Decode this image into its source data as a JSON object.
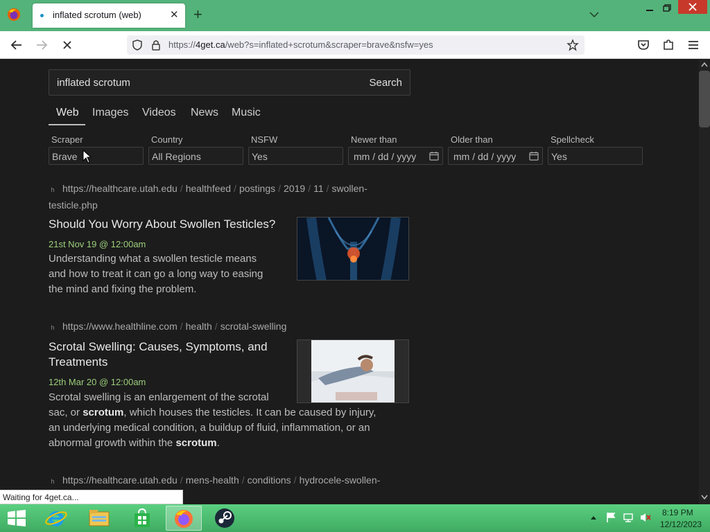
{
  "browser": {
    "tab_title": "inflated scrotum (web)",
    "url_prefix": "https://",
    "url_host": "4get.ca",
    "url_rest": "/web?s=inflated+scrotum&scraper=brave&nsfw=yes",
    "status": "Waiting for 4get.ca..."
  },
  "search": {
    "query": "inflated scrotum",
    "button": "Search"
  },
  "tabs": [
    "Web",
    "Images",
    "Videos",
    "News",
    "Music"
  ],
  "filters": {
    "scraper": {
      "label": "Scraper",
      "value": "Brave"
    },
    "country": {
      "label": "Country",
      "value": "All Regions"
    },
    "nsfw": {
      "label": "NSFW",
      "value": "Yes"
    },
    "newer": {
      "label": "Newer than",
      "value": "mm / dd / yyyy"
    },
    "older": {
      "label": "Older than",
      "value": "mm / dd / yyyy"
    },
    "spellcheck": {
      "label": "Spellcheck",
      "value": "Yes"
    }
  },
  "results": [
    {
      "favicon": "h",
      "url_base": "https://healthcare.utah.edu",
      "url_parts": [
        "healthfeed",
        "postings",
        "2019",
        "11",
        "swollen-"
      ],
      "url_wrap": "testicle.php",
      "title": "Should You Worry About Swollen Testicles?",
      "date": "21st Nov 19 @ 12:00am",
      "desc_lines": [
        "Understanding what a swollen testicle means",
        "and how to treat it can go a long way to easing",
        "the mind and fixing the problem."
      ]
    },
    {
      "favicon": "h",
      "url_base": "https://www.healthline.com",
      "url_parts": [
        "health",
        "scrotal-swelling"
      ],
      "title_lines": [
        "Scrotal Swelling: Causes, Symptoms, and",
        "Treatments"
      ],
      "date": "12th Mar 20 @ 12:00am",
      "desc_1": "Scrotal swelling is an enlargement of the scrotal",
      "desc_2a": "sac, or ",
      "desc_2b": "scrotum",
      "desc_2c": ", which houses the testicles. It can be caused by injury,",
      "desc_3": "an underlying medical condition, a buildup of fluid, inflammation, or an",
      "desc_4a": "abnormal growth within the ",
      "desc_4b": "scrotum",
      "desc_4c": "."
    },
    {
      "favicon": "h",
      "url_base": "https://healthcare.utah.edu",
      "url_parts": [
        "mens-health",
        "conditions",
        "hydrocele-swollen-"
      ]
    }
  ],
  "taskbar": {
    "time": "8:19 PM",
    "date": "12/12/2023",
    "items": [
      "start-icon",
      "internet-explorer-icon",
      "file-explorer-icon",
      "store-icon",
      "firefox-icon",
      "steam-icon"
    ]
  },
  "colors": {
    "accent_green": "#54b37a",
    "date_green": "#9bcf7b",
    "page_bg": "#1c1c1c"
  }
}
